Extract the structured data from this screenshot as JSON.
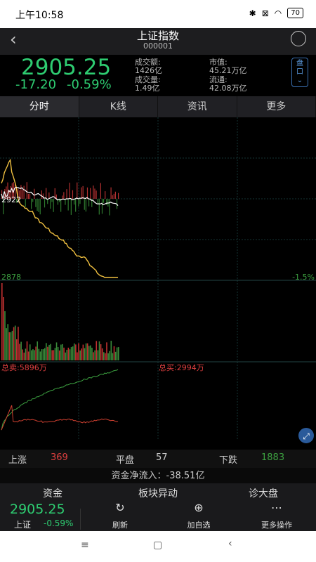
{
  "status": {
    "time": "上午10:58",
    "battery": "70"
  },
  "header": {
    "title": "上证指数",
    "code": "000001"
  },
  "quote": {
    "price": "2905.25",
    "change": "-17.20",
    "change_pct": "-0.59%",
    "turnover_label": "成交额:",
    "turnover": "1426亿",
    "volume_label": "成交量:",
    "volume": "1.49亿",
    "mktcap_label": "市值:",
    "mktcap": "45.21万亿",
    "float_label": "流通:",
    "float": "42.08万亿",
    "pankou_label": "盘口"
  },
  "tabs": [
    "分时",
    "K线",
    "资讯",
    "更多"
  ],
  "chart": {
    "prev_close_label": "2922",
    "low_label": "2878",
    "low_pct": "-1.5%",
    "total_sell_label": "总卖:5896万",
    "total_buy_label": "总买:2994万",
    "colors": {
      "price": "#ffffff",
      "avg": "#f0c040",
      "up": "#e04040",
      "down": "#40a040",
      "grid": "#1e3a3a"
    }
  },
  "breadth": {
    "up_label": "上涨",
    "up": "369",
    "flat_label": "平盘",
    "flat": "57",
    "down_label": "下跌",
    "down": "1883"
  },
  "flow": {
    "label": "资金净流入：",
    "value": "-38.51亿"
  },
  "toolbar": {
    "heads": [
      "资金",
      "板块异动",
      "诊大盘"
    ],
    "price": "2905.25",
    "index_name": "上证",
    "index_pct": "-0.59%",
    "refresh": "刷新",
    "add": "加自选",
    "more": "更多操作"
  }
}
